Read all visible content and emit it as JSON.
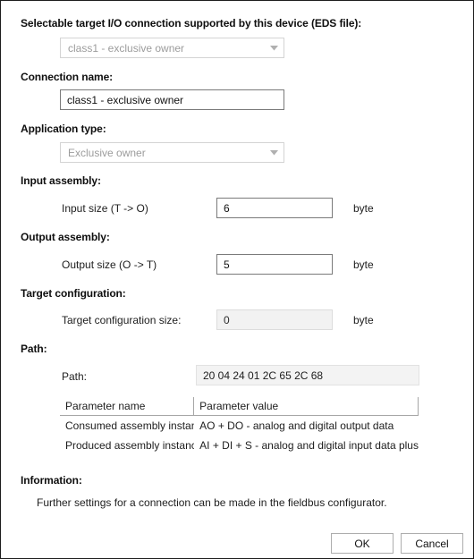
{
  "dialog": {
    "sections": {
      "selectable_target": "Selectable target I/O connection supported by this device (EDS file):",
      "connection_name": "Connection name:",
      "application_type": "Application type:",
      "input_assembly": "Input assembly:",
      "output_assembly": "Output assembly:",
      "target_configuration": "Target configuration:",
      "path": "Path:",
      "information": "Information:"
    },
    "fields": {
      "target_connection_combo": {
        "value": "class1 - exclusive owner",
        "enabled": false,
        "icon": "chevron-down-icon"
      },
      "connection_name_input": {
        "value": "class1 - exclusive owner",
        "placeholder": "",
        "enabled": true
      },
      "application_type_combo": {
        "value": "Exclusive owner",
        "enabled": false,
        "icon": "chevron-down-icon"
      },
      "input_size": {
        "label": "Input size (T -> O)",
        "value": "6",
        "unit": "byte",
        "enabled": true
      },
      "output_size": {
        "label": "Output size (O -> T)",
        "value": "5",
        "unit": "byte",
        "enabled": true
      },
      "target_config_size": {
        "label": "Target configuration size:",
        "value": "0",
        "unit": "byte",
        "enabled": false
      },
      "path_value": {
        "label": "Path:",
        "value": "20 04 24 01 2C 65 2C 68",
        "enabled": false
      }
    },
    "parameter_table": {
      "columns": [
        "Parameter name",
        "Parameter value"
      ],
      "rows": [
        {
          "name": "Consumed assembly instance",
          "value": "AO + DO - analog and digital output data"
        },
        {
          "name": "Produced assembly instance :",
          "value": "AI + DI + S - analog and digital input data plus sta"
        }
      ]
    },
    "information_text": "Further settings for a connection can be made in the fieldbus configurator.",
    "buttons": {
      "ok": "OK",
      "cancel": "Cancel"
    }
  }
}
